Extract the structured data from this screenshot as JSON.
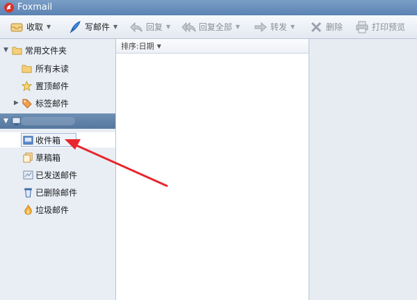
{
  "window": {
    "title": "Foxmail"
  },
  "toolbar": {
    "receive": "收取",
    "compose": "写邮件",
    "reply": "回复",
    "reply_all": "回复全部",
    "forward": "转发",
    "delete": "删除",
    "print_preview": "打印预览"
  },
  "sidebar": {
    "common_folders": {
      "label": "常用文件夹",
      "items": [
        "所有未读",
        "置顶邮件",
        "标签邮件"
      ]
    },
    "account": {
      "folders": [
        "收件箱",
        "草稿箱",
        "已发送邮件",
        "已删除邮件",
        "垃圾邮件"
      ]
    }
  },
  "list": {
    "sort_label": "排序:日期"
  },
  "colors": {
    "annotation_arrow": "#e8262c",
    "titlebar": "#6a90bc",
    "account_bar": "#5f81a8"
  }
}
